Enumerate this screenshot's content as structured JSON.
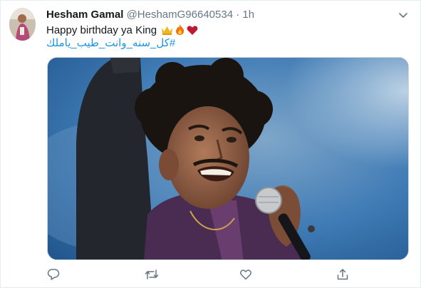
{
  "tweet": {
    "display_name": "Hesham Gamal",
    "handle": "@HeshamG96640534",
    "separator": "·",
    "time": "1h",
    "text": "Happy birthday ya King",
    "hashtag": "#كل_سنه_وانت_طيب_ياملك"
  },
  "icons": {
    "caret": "chevron-down-icon",
    "reply": "reply-icon",
    "retweet": "retweet-icon",
    "like": "heart-icon",
    "share": "share-icon",
    "emoji": [
      "crown-emoji",
      "fire-emoji",
      "heart-emoji"
    ]
  },
  "colors": {
    "name": "#14171a",
    "meta": "#657786",
    "link": "#1b95e0",
    "border": "#e6ecf0",
    "icon": "#657786"
  }
}
